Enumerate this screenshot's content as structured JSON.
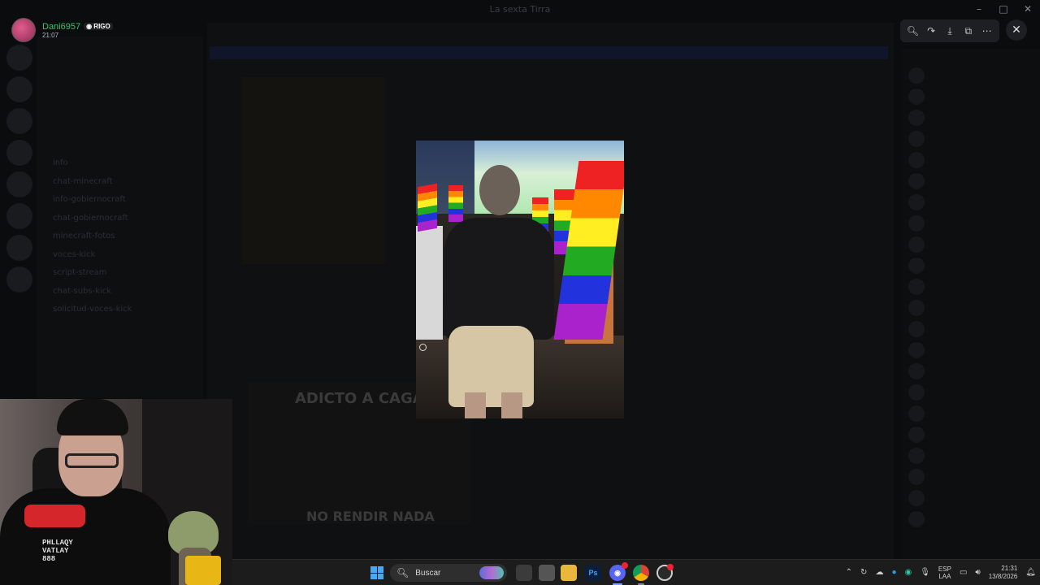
{
  "window": {
    "title": "La sexta Tirra",
    "controls": [
      "–",
      "□",
      "✕"
    ]
  },
  "user": {
    "name": "Dani6957",
    "badge": "RIGO",
    "time": "21:07"
  },
  "viewer": {
    "tools": [
      "zoom-in-icon",
      "forward-icon",
      "download-icon",
      "open-external-icon",
      "more-icon"
    ],
    "close": "✕"
  },
  "background": {
    "channels": [
      "info",
      "chat-minecraft",
      "info-gobiernocraft",
      "chat-gobiernocraft",
      "minecraft-fotos",
      "voces-kick",
      "script-stream",
      "chat-subs-kick",
      "solicitud-voces-kick"
    ],
    "meme_top": "ADICTO A CAGAR",
    "meme_bottom": "NO RENDIR NADA"
  },
  "webcam": {
    "hoodie_text": "PHLLAQY\nVATLAY\n888"
  },
  "taskbar": {
    "search_label": "Buscar",
    "apps": [
      "Task View",
      "Files",
      "Explorer",
      "Ps",
      "Discord",
      "Chrome",
      "App"
    ],
    "language": [
      "ESP",
      "LAA"
    ],
    "time": "21:31",
    "date": "13/8/2026"
  }
}
